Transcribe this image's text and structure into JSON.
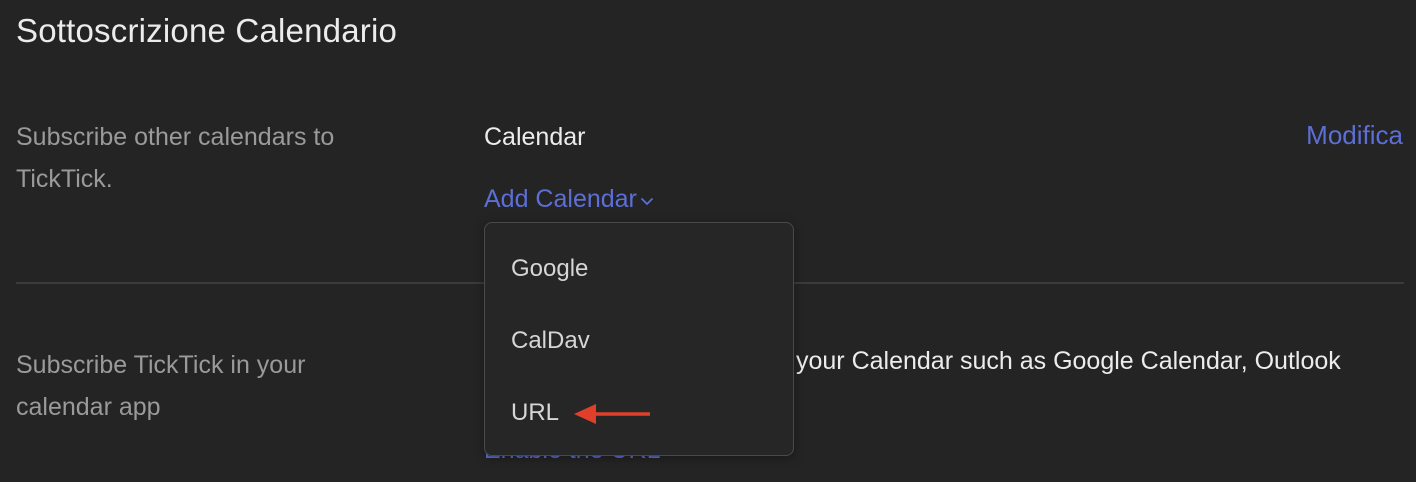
{
  "page": {
    "title": "Sottoscrizione Calendario"
  },
  "subscribe_others": {
    "description": "Subscribe other calendars to TickTick.",
    "calendar_label": "Calendar",
    "edit_label": "Modifica",
    "add_calendar_label": "Add Calendar",
    "dropdown": {
      "items": [
        {
          "label": "Google"
        },
        {
          "label": "CalDav"
        },
        {
          "label": "URL"
        }
      ]
    }
  },
  "subscribe_ticktick": {
    "description": "Subscribe TickTick in your calendar app",
    "text_partial": "your Calendar such as Google Calendar, Outlook",
    "enable_url_label": "Enable the URL"
  },
  "colors": {
    "background": "#242424",
    "accent": "#5c6fd6",
    "annotation_arrow": "#e0402a"
  },
  "icons": {
    "chevron": "chevron-down-icon",
    "arrow": "arrow-left-icon"
  }
}
